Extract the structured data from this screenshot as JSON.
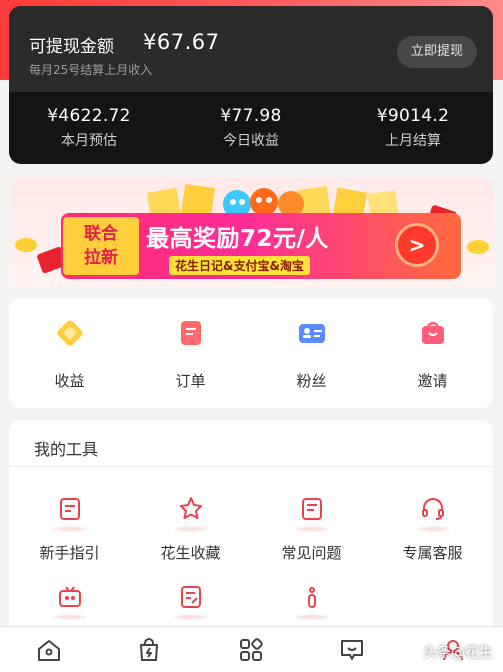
{
  "earnings": {
    "title": "可提现金额",
    "amount": "¥67.67",
    "subtitle": "每月25号结算上月收入",
    "withdraw_label": "立即提现",
    "stats": [
      {
        "value": "¥4622.72",
        "label": "本月预估"
      },
      {
        "value": "¥77.98",
        "label": "今日收益"
      },
      {
        "value": "¥9014.2",
        "label": "上月结算"
      }
    ]
  },
  "banner": {
    "tag_line1": "联合",
    "tag_line2": "拉新",
    "headline": "最高奖励72元/人",
    "partners": "花生日记&支付宝&淘宝",
    "go_label": ">"
  },
  "quick_actions": [
    {
      "label": "收益",
      "icon": "diamond-icon"
    },
    {
      "label": "订单",
      "icon": "order-icon"
    },
    {
      "label": "粉丝",
      "icon": "fans-icon"
    },
    {
      "label": "邀请",
      "icon": "invite-bag-icon"
    }
  ],
  "tools": {
    "title": "我的工具",
    "items": [
      {
        "label": "新手指引",
        "icon": "guide-icon"
      },
      {
        "label": "花生收藏",
        "icon": "star-icon"
      },
      {
        "label": "常见问题",
        "icon": "faq-icon"
      },
      {
        "label": "专属客服",
        "icon": "headset-icon"
      },
      {
        "label": "",
        "icon": "tv-icon"
      },
      {
        "label": "",
        "icon": "edit-doc-icon"
      },
      {
        "label": "",
        "icon": "info-icon"
      }
    ]
  },
  "tabbar": {
    "tabs": [
      "home-icon",
      "bag-icon",
      "apps-icon",
      "message-icon",
      "profile-icon"
    ]
  },
  "watermark": "头条@花生",
  "colors": {
    "accent": "#ff3b3b",
    "dark_card": "#141414",
    "tool_icon": "#e8434f"
  }
}
